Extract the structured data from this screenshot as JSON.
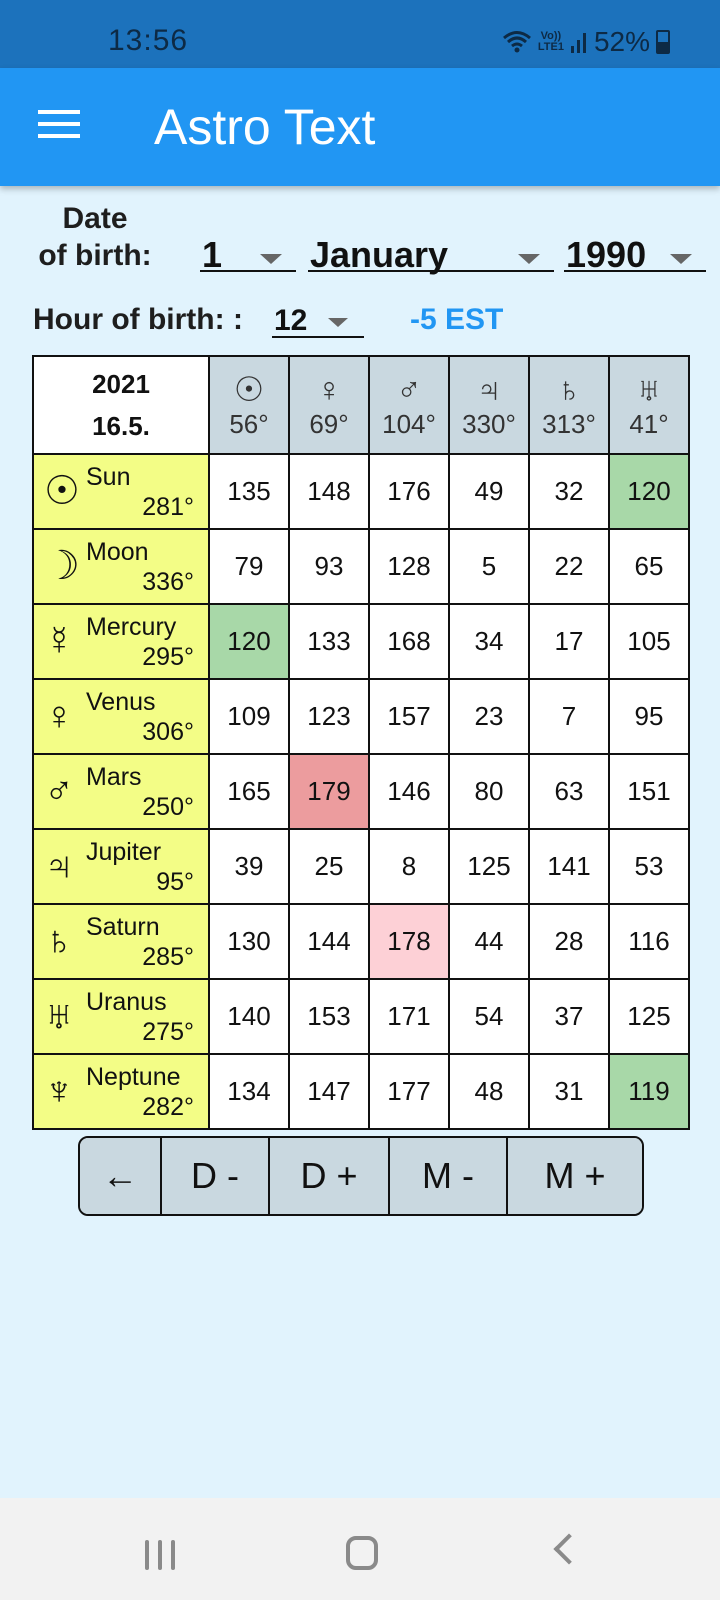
{
  "status_bar": {
    "time": "13:56",
    "network_label_top": "Vo))",
    "network_label_bottom": "LTE1",
    "battery": "52%",
    "icons": [
      "wifi-icon",
      "signal-icon",
      "battery-icon"
    ]
  },
  "app_bar": {
    "title": "Astro Text",
    "menu_icon": "hamburger-menu-icon"
  },
  "form": {
    "dob_label_line1": "Date",
    "dob_label_line2": "of birth:",
    "day": "1",
    "month": "January",
    "year": "1990",
    "hour_label": "Hour of birth: :",
    "hour": "12",
    "timezone": "-5 EST"
  },
  "table": {
    "corner_year": "2021",
    "corner_date": "16.5.",
    "columns": [
      {
        "symbol": "☉",
        "planet": "Sun",
        "degree": "56°"
      },
      {
        "symbol": "♀",
        "planet": "Venus",
        "degree": "69°"
      },
      {
        "symbol": "♂",
        "planet": "Mars",
        "degree": "104°"
      },
      {
        "symbol": "♃",
        "planet": "Jupiter",
        "degree": "330°"
      },
      {
        "symbol": "♄",
        "planet": "Saturn",
        "degree": "313°"
      },
      {
        "symbol": "♅",
        "planet": "Uranus",
        "degree": "41°"
      }
    ],
    "rows": [
      {
        "symbol": "☉",
        "name": "Sun",
        "degree": "281°",
        "values": [
          "135",
          "148",
          "176",
          "49",
          "32",
          "120"
        ],
        "highlights": [
          "",
          "",
          "",
          "",
          "",
          "green"
        ]
      },
      {
        "symbol": "☽",
        "name": "Moon",
        "degree": "336°",
        "values": [
          "79",
          "93",
          "128",
          "5",
          "22",
          "65"
        ],
        "highlights": [
          "",
          "",
          "",
          "",
          "",
          ""
        ]
      },
      {
        "symbol": "☿",
        "name": "Mercury",
        "degree": "295°",
        "values": [
          "120",
          "133",
          "168",
          "34",
          "17",
          "105"
        ],
        "highlights": [
          "green",
          "",
          "",
          "",
          "",
          ""
        ]
      },
      {
        "symbol": "♀",
        "name": "Venus",
        "degree": "306°",
        "values": [
          "109",
          "123",
          "157",
          "23",
          "7",
          "95"
        ],
        "highlights": [
          "",
          "",
          "",
          "",
          "",
          ""
        ]
      },
      {
        "symbol": "♂",
        "name": "Mars",
        "degree": "250°",
        "values": [
          "165",
          "179",
          "146",
          "80",
          "63",
          "151"
        ],
        "highlights": [
          "",
          "red",
          "",
          "",
          "",
          ""
        ]
      },
      {
        "symbol": "♃",
        "name": "Jupiter",
        "degree": "95°",
        "values": [
          "39",
          "25",
          "8",
          "125",
          "141",
          "53"
        ],
        "highlights": [
          "",
          "",
          "",
          "",
          "",
          ""
        ]
      },
      {
        "symbol": "♄",
        "name": "Saturn",
        "degree": "285°",
        "values": [
          "130",
          "144",
          "178",
          "44",
          "28",
          "116"
        ],
        "highlights": [
          "",
          "",
          "pink",
          "",
          "",
          ""
        ]
      },
      {
        "symbol": "♅",
        "name": "Uranus",
        "degree": "275°",
        "values": [
          "140",
          "153",
          "171",
          "54",
          "37",
          "125"
        ],
        "highlights": [
          "",
          "",
          "",
          "",
          "",
          ""
        ]
      },
      {
        "symbol": "♆",
        "name": "Neptune",
        "degree": "282°",
        "values": [
          "134",
          "147",
          "177",
          "48",
          "31",
          "119"
        ],
        "highlights": [
          "",
          "",
          "",
          "",
          "",
          "green"
        ]
      }
    ],
    "highlight_colors": {
      "green": "#a8d8a8",
      "red": "#ec9c9e",
      "pink": "#fdd0d6"
    }
  },
  "buttons": {
    "back": "←",
    "day_minus": "D -",
    "day_plus": "D +",
    "month_minus": "M -",
    "month_plus": "M +"
  },
  "colors": {
    "app_bar": "#2196f3",
    "status_bar": "#1c72bc",
    "background": "#e1f3fd",
    "row_header": "#f3fd86",
    "col_header": "#c9d8e0",
    "timezone_text": "#2196f3"
  }
}
